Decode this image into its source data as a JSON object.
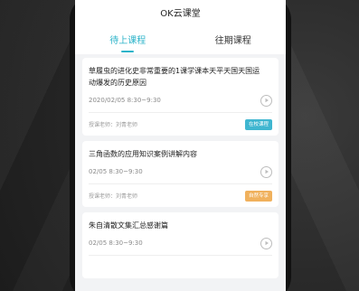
{
  "app": {
    "title": "OK云课堂"
  },
  "tabs": [
    {
      "label": "待上课程",
      "active": true
    },
    {
      "label": "往期课程",
      "active": false
    }
  ],
  "courses": [
    {
      "title": "草履虫的进化史非常重要的1课学课本天平天国天国运动爆发的历史原因",
      "time": "2020/02/05  8:30~9:30",
      "teacher": "授课老师：刘青老师",
      "badge": "在校课程",
      "badge_color": "#3fb6d0"
    },
    {
      "title": "三角函数的应用知识案例讲解内容",
      "time": "02/05  8:30~9:30",
      "teacher": "授课老师：刘青老师",
      "badge": "自然专享",
      "badge_color": "#f0b15d"
    },
    {
      "title": "朱自清散文集汇总感谢篇",
      "time": "02/05  8:30~9:30"
    }
  ],
  "icons": {
    "play": "play-icon"
  },
  "colors": {
    "accent": "#2bb3c9"
  }
}
